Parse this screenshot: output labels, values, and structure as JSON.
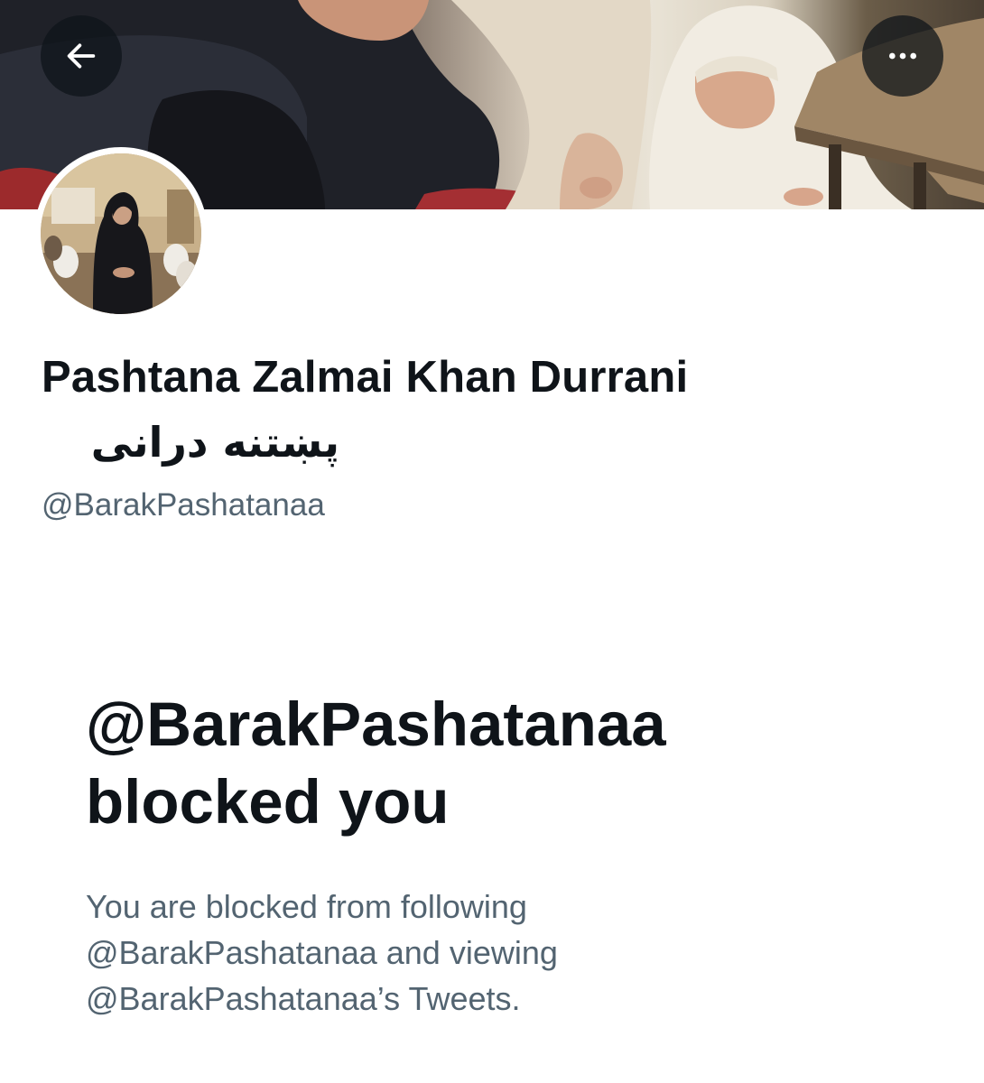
{
  "header": {
    "back_icon": "arrow-left-icon",
    "more_icon": "more-horizontal-icon"
  },
  "profile": {
    "display_name": "Pashtana Zalmai Khan Durrani",
    "display_name_native": "پښتنه درانی",
    "handle": "@BarakPashatanaa"
  },
  "blocked_notice": {
    "title_line1": "@BarakPashatanaa",
    "title_line2": "blocked you",
    "desc_line1": "You are blocked from following",
    "desc_line2": "@BarakPashatanaa and viewing",
    "desc_line3": "@BarakPashatanaa’s Tweets."
  },
  "colors": {
    "primary_text": "#0f1419",
    "secondary_text": "#536471",
    "background": "#ffffff",
    "overlay_button": "#0f1419"
  }
}
